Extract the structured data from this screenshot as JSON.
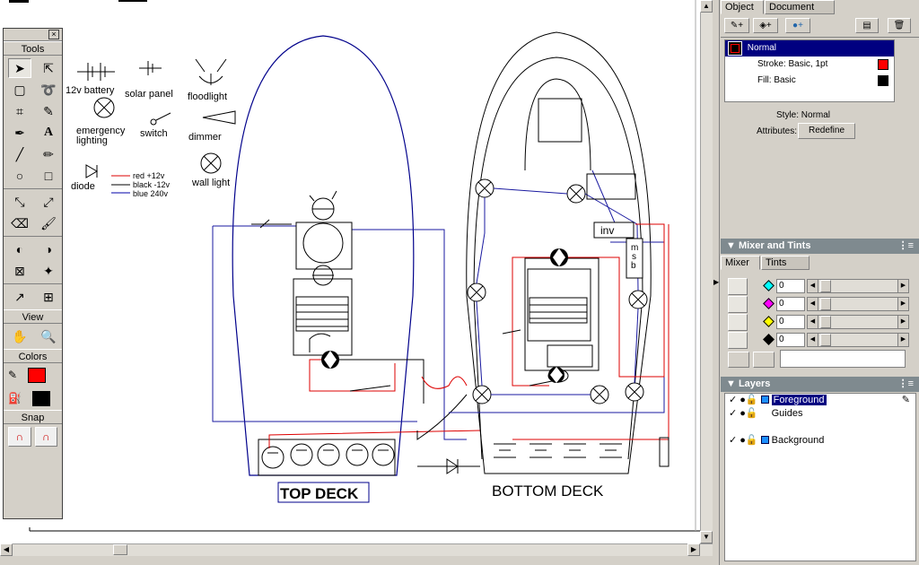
{
  "tools_panel": {
    "title": "Tools",
    "close_glyph": "×",
    "view_label": "View",
    "colors_label": "Colors",
    "snap_label": "Snap",
    "stroke_color": "#ff0000",
    "fill_color": "#000000",
    "tools": [
      "pointer-tool",
      "subselect-tool",
      "select-behind-tool",
      "lasso-tool",
      "crop-tool",
      "eyedropper-tool",
      "pen-tool",
      "text-tool",
      "line-tool",
      "pencil-tool",
      "ellipse-tool",
      "rectangle-tool",
      "scale-tool",
      "skew-tool",
      "eraser-tool",
      "brush-tool",
      "freeform-tool",
      "reshape-tool",
      "paint-bucket-tool",
      "gradient-tool",
      "rubber-stamp-tool",
      "hotspot-tool"
    ],
    "view_tools": [
      "hand-icon",
      "zoom-icon"
    ]
  },
  "legend": {
    "battery": "12v battery",
    "solar": "solar panel",
    "flood": "floodlight",
    "emergency_line1": "emergency",
    "emergency_line2": "lighting",
    "switch": "switch",
    "dimmer": "dimmer",
    "diode": "diode",
    "red": "red +12v",
    "black": "black -12v",
    "blue": "blue 240v",
    "wall": "wall light"
  },
  "drawing": {
    "top_deck": "TOP DECK",
    "bottom_deck": "BOTTOM DECK",
    "inv": "inv",
    "msb1": "m",
    "msb2": "s",
    "msb3": "b"
  },
  "object_panel": {
    "tabs": [
      "Object",
      "Document"
    ],
    "items": [
      {
        "label": "Normal",
        "color": "#ff0000"
      },
      {
        "label": "Stroke: Basic, 1pt",
        "color": "#ff0000"
      },
      {
        "label": "Fill: Basic",
        "color": "#000000"
      }
    ],
    "style_label": "Style: Normal",
    "attributes_label": "Attributes:",
    "redefine_label": "Redefine"
  },
  "mixer_panel": {
    "title": "Mixer and Tints",
    "tabs": [
      "Mixer",
      "Tints"
    ],
    "channels": [
      {
        "color": "#00ffff",
        "value": "0"
      },
      {
        "color": "#ff00ff",
        "value": "0"
      },
      {
        "color": "#ffff00",
        "value": "0"
      },
      {
        "color": "#000000",
        "value": "0"
      }
    ]
  },
  "layers_panel": {
    "title": "Layers",
    "layers": [
      "Foreground",
      "Guides",
      "Background"
    ]
  }
}
